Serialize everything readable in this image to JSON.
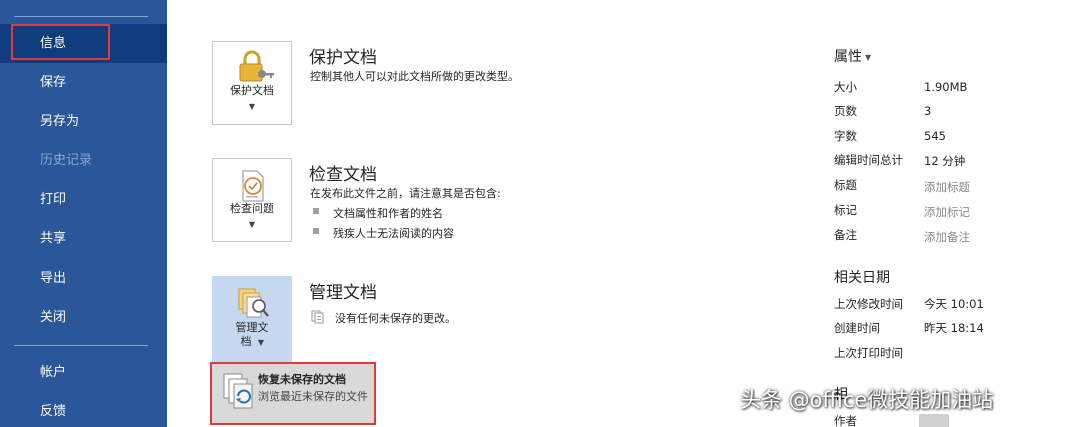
{
  "sidebar": {
    "items": [
      {
        "label": "信息"
      },
      {
        "label": "保存"
      },
      {
        "label": "另存为"
      },
      {
        "label": "历史记录"
      },
      {
        "label": "打印"
      },
      {
        "label": "共享"
      },
      {
        "label": "导出"
      },
      {
        "label": "关闭"
      },
      {
        "label": "帐户"
      },
      {
        "label": "反馈"
      }
    ]
  },
  "protect": {
    "tile_label": "保护文档",
    "title": "保护文档",
    "desc": "控制其他人可以对此文档所做的更改类型。",
    "icon": "lock-key-icon"
  },
  "inspect": {
    "tile_label": "检查问题",
    "title": "检查文档",
    "desc": "在发布此文件之前，请注意其是否包含:",
    "bullets": [
      "文档属性和作者的姓名",
      "残疾人士无法阅读的内容"
    ],
    "icon": "checklist-icon"
  },
  "manage": {
    "tile_label_1": "管理文",
    "tile_label_2": "档",
    "title": "管理文档",
    "desc": "没有任何未保存的更改。",
    "icon": "manage-documents-icon"
  },
  "recover_menu": {
    "title": "恢复未保存的文档",
    "desc": "浏览最近未保存的文件"
  },
  "properties": {
    "heading": "属性",
    "rows": [
      {
        "label": "大小",
        "value": "1.90MB"
      },
      {
        "label": "页数",
        "value": "3"
      },
      {
        "label": "字数",
        "value": "545"
      },
      {
        "label": "编辑时间总计",
        "value": "12 分钟"
      },
      {
        "label": "标题",
        "value": "添加标题"
      },
      {
        "label": "标记",
        "value": "添加标记"
      },
      {
        "label": "备注",
        "value": "添加备注"
      }
    ]
  },
  "dates": {
    "heading": "相关日期",
    "rows": [
      {
        "label": "上次修改时间",
        "value": "今天 10:01"
      },
      {
        "label": "创建时间",
        "value": "昨天 18:14"
      },
      {
        "label": "上次打印时间",
        "value": ""
      }
    ]
  },
  "people": {
    "heading_partial": "相",
    "author_label": "作者"
  },
  "watermark": "头条 @office微技能加油站",
  "colors": {
    "sidebar_bg": "#2b579a",
    "sidebar_active": "#103b7d",
    "highlight_border": "#e03a3a",
    "tile_selected": "#c5d8ef"
  }
}
